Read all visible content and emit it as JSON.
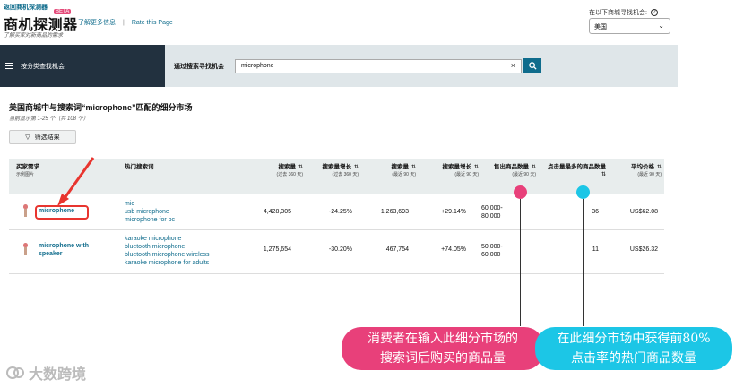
{
  "header": {
    "back_link": "返回商机探测器",
    "app_title": "商机探测器",
    "beta": "BETA",
    "learn_more": "了解更多信息",
    "separator": "|",
    "rate_page": "Rate this Page",
    "subtitle": "了解买家对新商品的需求",
    "market_label": "在以下商城寻找机会:",
    "market_value": "美国"
  },
  "nav": {
    "browse_label": "按分类查找机会",
    "search_label": "通过搜索寻找机会",
    "search_value": "microphone"
  },
  "results": {
    "title": "美国商城中与搜索词“microphone”匹配的细分市场",
    "count": "当前显示第 1-25 个（共 108 个）",
    "filter_label": "筛选结果"
  },
  "table": {
    "headers": {
      "niche": "买家需求",
      "niche_sub": "示例图片",
      "keywords": "热门搜索词",
      "search_volume": "搜索量",
      "search_volume_sub": "(过去 360 天)",
      "search_growth": "搜索量增长",
      "search_growth_sub": "(过去 360 天)",
      "search_volume90": "搜索量",
      "search_volume90_sub": "(最近 90 天)",
      "search_growth90": "搜索量增长",
      "search_growth90_sub": "(最近 90 天)",
      "units_sold": "售出商品数量",
      "units_sold_sub": "(最近 90 天)",
      "top_clicked": "点击量最多的商品数量",
      "avg_price": "平均价格",
      "avg_price_sub": "(最近 90 天)"
    },
    "rows": [
      {
        "niche": "microphone",
        "keywords": [
          "mic",
          "usb microphone",
          "microphone for pc"
        ],
        "search_volume": "4,428,305",
        "search_growth": "-24.25%",
        "search_volume90": "1,263,693",
        "search_growth90": "+29.14%",
        "units_sold": "60,000-80,000",
        "top_clicked": "36",
        "avg_price": "US$62.08"
      },
      {
        "niche": "microphone with speaker",
        "keywords": [
          "karaoke microphone",
          "bluetooth microphone",
          "bluetooth microphone wireless",
          "karaoke microphone for adults"
        ],
        "search_volume": "1,275,654",
        "search_growth": "-30.20%",
        "search_volume90": "467,754",
        "search_growth90": "+74.05%",
        "units_sold": "50,000-60,000",
        "top_clicked": "11",
        "avg_price": "US$26.32"
      }
    ]
  },
  "annotations": {
    "pink_bubble": [
      "消费者在输入此细分市场的",
      "搜索词后购买的商品量"
    ],
    "cyan_bubble": [
      "在此细分市场中获得前80%",
      "点击率的热门商品数量"
    ],
    "pink_color": "#e8407a",
    "cyan_color": "#1cc6e6"
  },
  "watermark": "大数跨境"
}
